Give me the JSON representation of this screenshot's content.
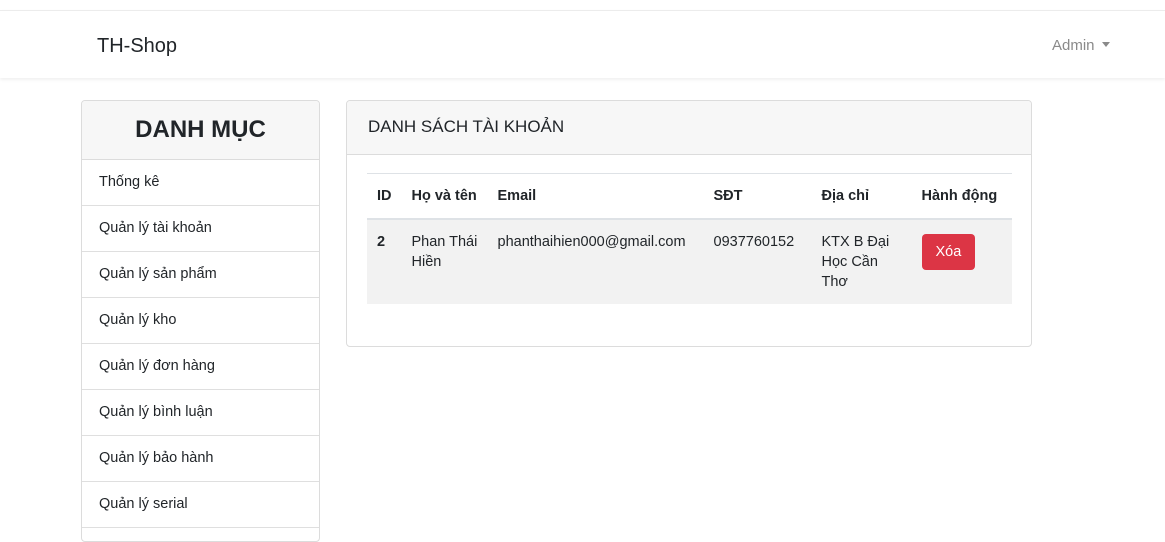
{
  "navbar": {
    "brand": "TH-Shop",
    "user_menu": "Admin"
  },
  "sidebar": {
    "title": "DANH MỤC",
    "items": [
      {
        "label": "Thống kê"
      },
      {
        "label": "Quản lý tài khoản"
      },
      {
        "label": "Quản lý sản phẩm"
      },
      {
        "label": "Quản lý kho"
      },
      {
        "label": "Quản lý đơn hàng"
      },
      {
        "label": "Quản lý bình luận"
      },
      {
        "label": "Quản lý bảo hành"
      },
      {
        "label": "Quản lý serial"
      }
    ]
  },
  "main": {
    "title": "DANH SÁCH TÀI KHOẢN",
    "table": {
      "headers": [
        "ID",
        "Họ và tên",
        "Email",
        "SĐT",
        "Địa chỉ",
        "Hành động"
      ],
      "rows": [
        {
          "id": "2",
          "name": "Phan Thái Hiền",
          "email": "phanthaihien000@gmail.com",
          "phone": "0937760152",
          "address": "KTX B Đại Học Cần Thơ",
          "action": "Xóa"
        }
      ]
    }
  },
  "colors": {
    "danger": "#dc3545",
    "header_bg": "#f7f7f7",
    "row_bg": "#f2f2f2"
  },
  "icons": {
    "user_menu": "caret-down-icon"
  }
}
